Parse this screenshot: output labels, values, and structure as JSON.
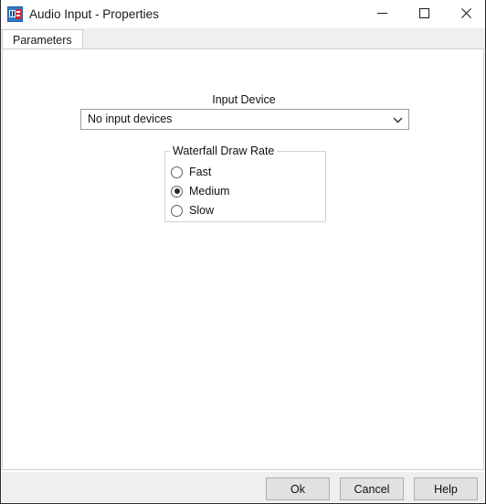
{
  "window": {
    "title": "Audio Input - Properties",
    "app_icon": "audio-input-app-icon",
    "controls": {
      "minimize": "minimize-icon",
      "maximize": "maximize-icon",
      "close": "close-icon"
    }
  },
  "tabs": [
    {
      "label": "Parameters",
      "selected": true
    }
  ],
  "main": {
    "input_device": {
      "label": "Input Device",
      "value": "No input devices",
      "placeholder": "No input devices",
      "arrow_icon": "chevron-down-icon"
    },
    "waterfall_draw_rate": {
      "legend": "Waterfall Draw Rate",
      "options": [
        {
          "label": "Fast",
          "checked": false
        },
        {
          "label": "Medium",
          "checked": true
        },
        {
          "label": "Slow",
          "checked": false
        }
      ]
    }
  },
  "footer": {
    "buttons": [
      {
        "label": "Ok"
      },
      {
        "label": "Cancel"
      },
      {
        "label": "Help"
      }
    ]
  },
  "colors": {
    "window_bg": "#ffffff",
    "tabstrip_bg": "#efefef",
    "footer_bg": "#efefef",
    "panel_border": "#cfcfcf",
    "button_face": "#e1e1e1",
    "button_border": "#adadad",
    "text": "#111111",
    "icon_accent": "#1f5fa8"
  }
}
